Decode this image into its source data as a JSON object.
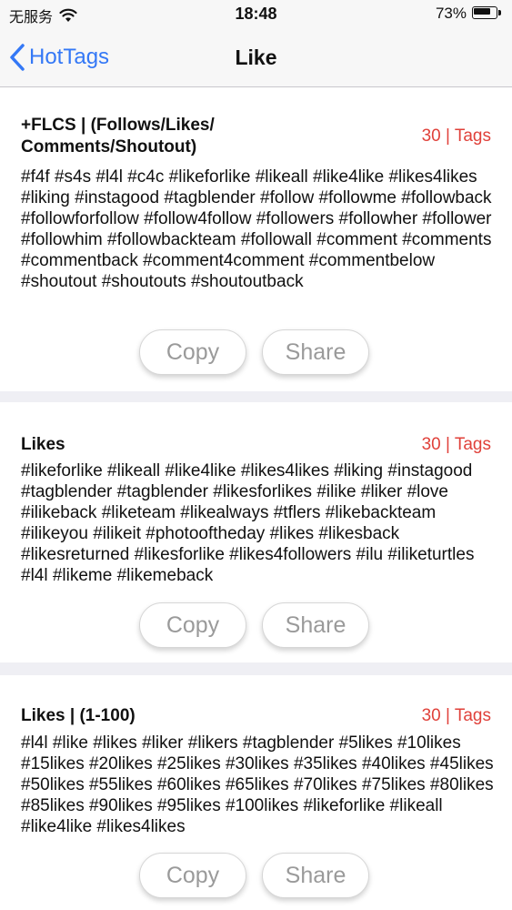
{
  "status_bar": {
    "carrier": "无服务",
    "time": "18:48",
    "battery": "73%",
    "battery_level": 0.73,
    "icons": [
      "wifi-icon",
      "battery-icon"
    ]
  },
  "nav": {
    "back_label": "HotTags",
    "title": "Like",
    "back_icon": "chevron-left-icon",
    "accent_color": "#3478f6"
  },
  "cards": [
    {
      "title": "+FLCS | (Follows/Likes/ Comments/Shoutout)",
      "count": "30 | Tags",
      "tags": "#f4f #s4s #l4l #c4c #likeforlike #likeall #like4like #likes4likes #liking #instagood #tagblender #follow #followme #followback #followforfollow #follow4follow #followers #followher #follower #followhim #followbackteam #followall #comment #comments #commentback #comment4comment #commentbelow #shoutout #shoutouts #shoutoutback",
      "copy_label": "Copy",
      "share_label": "Share"
    },
    {
      "title": "Likes",
      "count": "30 | Tags",
      "tags": "#likeforlike #likeall #like4like #likes4likes #liking #instagood #tagblender #tagblender #likesforlikes #ilike #liker #love #ilikeback #liketeam #likealways #tflers #likebackteam #ilikeyou #ilikeit #photooftheday #likes #likesback #likesreturned #likesforlike #likes4followers #ilu #iliketurtles #l4l #likeme #likemeback",
      "copy_label": "Copy",
      "share_label": "Share"
    },
    {
      "title": "Likes | (1-100)",
      "count": "30 | Tags",
      "tags": "#l4l #like #likes #liker #likers #tagblender #5likes #10likes #15likes #20likes #25likes #30likes #35likes #40likes #45likes #50likes #55likes #60likes #65likes #70likes #75likes #80likes #85likes #90likes #95likes #100likes #likeforlike #likeall #like4like #likes4likes",
      "copy_label": "Copy",
      "share_label": "Share"
    }
  ],
  "colors": {
    "count_red": "#e0413a",
    "background": "#efeff4"
  }
}
